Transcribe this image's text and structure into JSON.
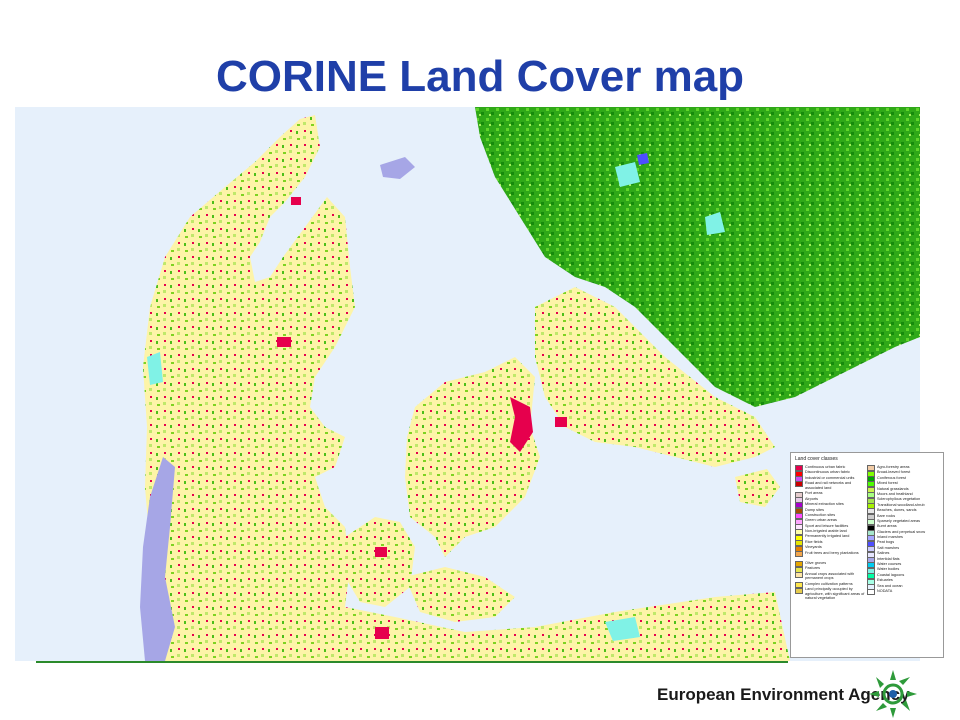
{
  "title": "CORINE Land Cover map",
  "colors": {
    "title": "#1f3fa8",
    "sea": "#e6f0fb",
    "arable": "#fdf4a8",
    "forest": "#3eb81a",
    "urban": "#e6004d",
    "coastal_flats": "#a6a6e6",
    "water": "#80f2e6",
    "footer_line": "#2b8a2b",
    "logo": "#2e9a3a"
  },
  "legend": {
    "title": "Land cover classes",
    "col1": [
      {
        "label": "Continuous urban fabric",
        "color": "#e6004d"
      },
      {
        "label": "Discontinuous urban fabric",
        "color": "#ff0000"
      },
      {
        "label": "Industrial or commercial units",
        "color": "#cc4df2"
      },
      {
        "label": "Road and rail networks and associated land",
        "color": "#cc0000"
      },
      {
        "label": "Port areas",
        "color": "#e6cccc"
      },
      {
        "label": "Airports",
        "color": "#e6cce6"
      },
      {
        "label": "Mineral extraction sites",
        "color": "#a600cc"
      },
      {
        "label": "Dump sites",
        "color": "#a64d00"
      },
      {
        "label": "Construction sites",
        "color": "#ff4dff"
      },
      {
        "label": "Green urban areas",
        "color": "#ffa6ff"
      },
      {
        "label": "Sport and leisure facilities",
        "color": "#ffe6ff"
      },
      {
        "label": "Non-irrigated arable land",
        "color": "#ffffa8"
      },
      {
        "label": "Permanently irrigated land",
        "color": "#ffff00"
      },
      {
        "label": "Rice fields",
        "color": "#e6e600"
      },
      {
        "label": "Vineyards",
        "color": "#e68000"
      },
      {
        "label": "Fruit trees and berry plantations",
        "color": "#f2a64d"
      },
      {
        "label": "Olive groves",
        "color": "#e6a600"
      },
      {
        "label": "Pastures",
        "color": "#e6e64d"
      },
      {
        "label": "Annual crops associated with permanent crops",
        "color": "#ffe6a6"
      },
      {
        "label": "Complex cultivation patterns",
        "color": "#ffe64d"
      },
      {
        "label": "Land principally occupied by agriculture, with significant areas of natural vegetation",
        "color": "#e6cc4d"
      }
    ],
    "col2": [
      {
        "label": "Agro-forestry areas",
        "color": "#f2cca6"
      },
      {
        "label": "Broad-leaved forest",
        "color": "#80ff00"
      },
      {
        "label": "Coniferous forest",
        "color": "#00a600"
      },
      {
        "label": "Mixed forest",
        "color": "#4dff00"
      },
      {
        "label": "Natural grasslands",
        "color": "#ccf24d"
      },
      {
        "label": "Moors and heathland",
        "color": "#a6ff80"
      },
      {
        "label": "Sclerophyllous vegetation",
        "color": "#a6e64d"
      },
      {
        "label": "Transitional woodland-shrub",
        "color": "#a6f200"
      },
      {
        "label": "Beaches, dunes, sands",
        "color": "#e6e6e6"
      },
      {
        "label": "Bare rocks",
        "color": "#cccccc"
      },
      {
        "label": "Sparsely vegetated areas",
        "color": "#ccffcc"
      },
      {
        "label": "Burnt areas",
        "color": "#000000"
      },
      {
        "label": "Glaciers and perpetual snow",
        "color": "#a6e6cc"
      },
      {
        "label": "Inland marshes",
        "color": "#a6a6ff"
      },
      {
        "label": "Peat bogs",
        "color": "#4d4dff"
      },
      {
        "label": "Salt marshes",
        "color": "#ccccff"
      },
      {
        "label": "Salines",
        "color": "#e6e6ff"
      },
      {
        "label": "Intertidal flats",
        "color": "#a6a6e6"
      },
      {
        "label": "Water courses",
        "color": "#00ccf2"
      },
      {
        "label": "Water bodies",
        "color": "#80f2e6"
      },
      {
        "label": "Coastal lagoons",
        "color": "#00ffa6"
      },
      {
        "label": "Estuaries",
        "color": "#a6ffe6"
      },
      {
        "label": "Sea and ocean",
        "color": "#e6f2ff"
      },
      {
        "label": "NODATA",
        "color": "#ffffff"
      }
    ]
  },
  "footer": {
    "agency": "European Environment Agency"
  }
}
